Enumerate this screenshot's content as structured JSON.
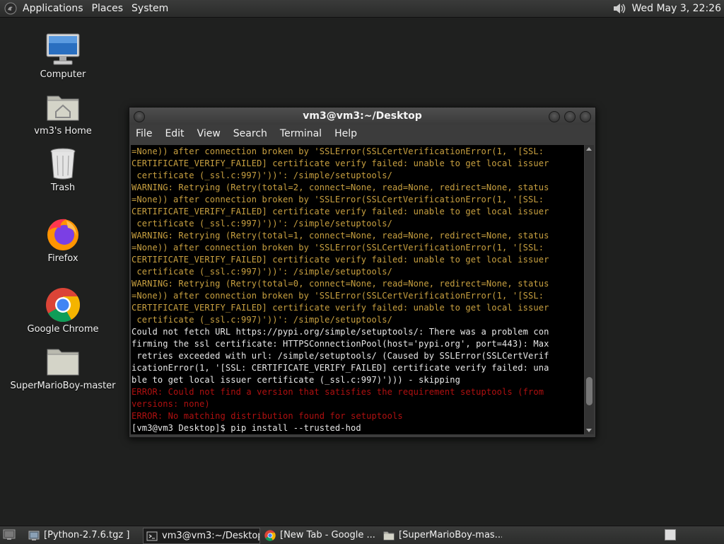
{
  "top_panel": {
    "menus": [
      "Applications",
      "Places",
      "System"
    ],
    "clock": "Wed May  3, 22:26"
  },
  "desktop_icons": [
    {
      "label": "Computer",
      "icon": "computer-icon"
    },
    {
      "label": "vm3's Home",
      "icon": "home-folder-icon"
    },
    {
      "label": "Trash",
      "icon": "trash-icon"
    },
    {
      "label": "Firefox",
      "icon": "firefox-icon"
    },
    {
      "label": "Google Chrome",
      "icon": "chrome-icon"
    },
    {
      "label": "SuperMarioBoy-master",
      "icon": "folder-icon"
    }
  ],
  "terminal": {
    "title": "vm3@vm3:~/Desktop",
    "menus": [
      "File",
      "Edit",
      "View",
      "Search",
      "Terminal",
      "Help"
    ],
    "lines": [
      {
        "type": "warn",
        "text": "=None)) after connection broken by 'SSLError(SSLCertVerificationError(1, '[SSL:"
      },
      {
        "type": "warn",
        "text": "CERTIFICATE_VERIFY_FAILED] certificate verify failed: unable to get local issuer"
      },
      {
        "type": "warn",
        "text": " certificate (_ssl.c:997)'))': /simple/setuptools/"
      },
      {
        "type": "warn",
        "text": "WARNING: Retrying (Retry(total=2, connect=None, read=None, redirect=None, status"
      },
      {
        "type": "warn",
        "text": "=None)) after connection broken by 'SSLError(SSLCertVerificationError(1, '[SSL:"
      },
      {
        "type": "warn",
        "text": "CERTIFICATE_VERIFY_FAILED] certificate verify failed: unable to get local issuer"
      },
      {
        "type": "warn",
        "text": " certificate (_ssl.c:997)'))': /simple/setuptools/"
      },
      {
        "type": "warn",
        "text": "WARNING: Retrying (Retry(total=1, connect=None, read=None, redirect=None, status"
      },
      {
        "type": "warn",
        "text": "=None)) after connection broken by 'SSLError(SSLCertVerificationError(1, '[SSL:"
      },
      {
        "type": "warn",
        "text": "CERTIFICATE_VERIFY_FAILED] certificate verify failed: unable to get local issuer"
      },
      {
        "type": "warn",
        "text": " certificate (_ssl.c:997)'))': /simple/setuptools/"
      },
      {
        "type": "warn",
        "text": "WARNING: Retrying (Retry(total=0, connect=None, read=None, redirect=None, status"
      },
      {
        "type": "warn",
        "text": "=None)) after connection broken by 'SSLError(SSLCertVerificationError(1, '[SSL:"
      },
      {
        "type": "warn",
        "text": "CERTIFICATE_VERIFY_FAILED] certificate verify failed: unable to get local issuer"
      },
      {
        "type": "warn",
        "text": " certificate (_ssl.c:997)'))': /simple/setuptools/"
      },
      {
        "type": "norm",
        "text": "Could not fetch URL https://pypi.org/simple/setuptools/: There was a problem con"
      },
      {
        "type": "norm",
        "text": "firming the ssl certificate: HTTPSConnectionPool(host='pypi.org', port=443): Max"
      },
      {
        "type": "norm",
        "text": " retries exceeded with url: /simple/setuptools/ (Caused by SSLError(SSLCertVerif"
      },
      {
        "type": "norm",
        "text": "icationError(1, '[SSL: CERTIFICATE_VERIFY_FAILED] certificate verify failed: una"
      },
      {
        "type": "norm",
        "text": "ble to get local issuer certificate (_ssl.c:997)'))) - skipping"
      },
      {
        "type": "err",
        "text": "ERROR: Could not find a version that satisfies the requirement setuptools (from"
      },
      {
        "type": "err",
        "text": "versions: none)"
      },
      {
        "type": "err",
        "text": "ERROR: No matching distribution found for setuptools"
      },
      {
        "type": "norm",
        "text": "[vm3@vm3 Desktop]$ pip install --trusted-hod"
      }
    ],
    "scroll_position": 0.92
  },
  "taskbar": {
    "items": [
      {
        "label": "[Python-2.7.6.tgz ]",
        "icon": "file-manager-icon",
        "active": false
      },
      {
        "label": "vm3@vm3:~/Desktop",
        "icon": "terminal-icon",
        "active": true
      },
      {
        "label": "[New Tab - Google ...",
        "icon": "chrome-icon",
        "active": false
      },
      {
        "label": "[SuperMarioBoy-mas...",
        "icon": "folder-icon",
        "active": false
      }
    ]
  },
  "colors": {
    "desktop_bg": "#1f201f",
    "terminal_bg": "#000000",
    "warning_text": "#c8a040",
    "error_text": "#b01010",
    "normal_text": "#e8e8e8"
  }
}
